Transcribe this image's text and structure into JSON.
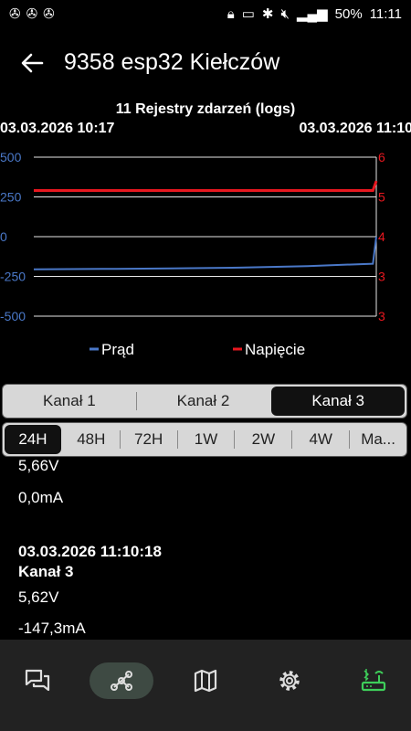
{
  "status": {
    "battery": "50%",
    "time": "11:11"
  },
  "appbar": {
    "title": "9358 esp32 Kiełczów"
  },
  "chart_data": {
    "type": "line",
    "title": "11 Rejestry zdarzeń (logs)",
    "x_start": "03.03.2026 10:17",
    "x_end": "03.03.2026 11:10",
    "y_left_ticks": [
      "500",
      "250",
      "0",
      "-250",
      "-500"
    ],
    "y_right_ticks": [
      "6",
      "5",
      "4",
      "3",
      "3"
    ],
    "ylim_left": [
      -500,
      500
    ],
    "ylim_right": [
      2.5,
      6.5
    ],
    "series": [
      {
        "name": "Prąd",
        "color": "#4a78c8",
        "axis": "left",
        "x": [
          0,
          0.2,
          0.4,
          0.6,
          0.8,
          0.99,
          1.0
        ],
        "values": [
          -205,
          -203,
          -200,
          -195,
          -185,
          -170,
          0
        ]
      },
      {
        "name": "Napięcie",
        "color": "#e8171f",
        "axis": "right",
        "x": [
          0,
          0.5,
          0.99,
          1.0
        ],
        "values": [
          5.66,
          5.66,
          5.66,
          5.9
        ]
      }
    ],
    "legend": "bottom"
  },
  "channels": {
    "items": [
      "Kanał 1",
      "Kanał 2",
      "Kanał 3"
    ],
    "active": 2
  },
  "ranges": {
    "items": [
      "24H",
      "48H",
      "72H",
      "1W",
      "2W",
      "4W",
      "Ma..."
    ],
    "active": 0
  },
  "log": {
    "partial": {
      "voltage": "5,66V",
      "current": "0,0mA"
    },
    "entry": {
      "timestamp": "03.03.2026 11:10:18",
      "channel": "Kanał 3",
      "voltage": "5,62V",
      "current": "-147,3mA"
    }
  },
  "nav": {
    "items": [
      "chat-icon",
      "graph-icon",
      "map-icon",
      "settings-icon",
      "router-icon"
    ],
    "active": 1,
    "accent": "#3ecf5a"
  }
}
